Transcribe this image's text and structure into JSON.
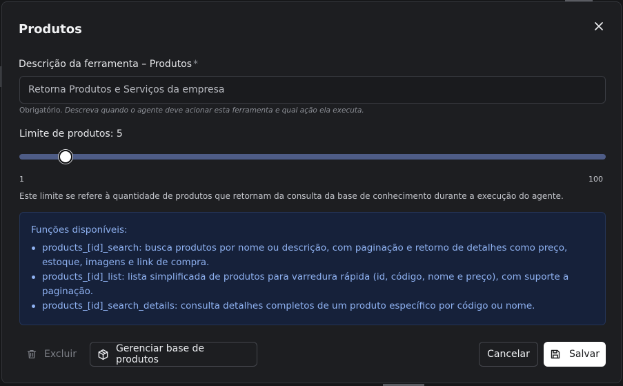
{
  "dialog": {
    "title": "Produtos",
    "close_icon": "close-icon"
  },
  "description_field": {
    "label": "Descrição da ferramenta – Produtos",
    "required_mark": "*",
    "value": "Retorna Produtos e Serviços da empresa",
    "hint_required": "Obrigatório.",
    "hint_text": "Descreva quando o agente deve acionar esta ferramenta e qual ação ela executa."
  },
  "limit": {
    "label": "Limite de produtos: 5",
    "value": 5,
    "min": 1,
    "max": 100,
    "min_label": "1",
    "max_label": "100",
    "note": "Este limite se refere à quantidade de produtos que retornam da consulta da base de conhecimento durante a execução do agente."
  },
  "functions": {
    "title": "Funções disponíveis:",
    "items": [
      "products_[id]_search: busca produtos por nome ou descrição, com paginação e retorno de detalhes como preço, estoque, imagens e link de compra.",
      "products_[id]_list: lista simplificada de produtos para varredura rápida (id, código, nome e preço), com suporte a paginação.",
      "products_[id]_search_details: consulta detalhes completos de um produto específico por código ou nome."
    ]
  },
  "footer": {
    "delete_label": "Excluir",
    "manage_label": "Gerenciar base de produtos",
    "cancel_label": "Cancelar",
    "save_label": "Salvar"
  },
  "colors": {
    "slider_track": "#4e5c86",
    "info_bg": "#16213a",
    "info_text": "#8fb2f2"
  }
}
